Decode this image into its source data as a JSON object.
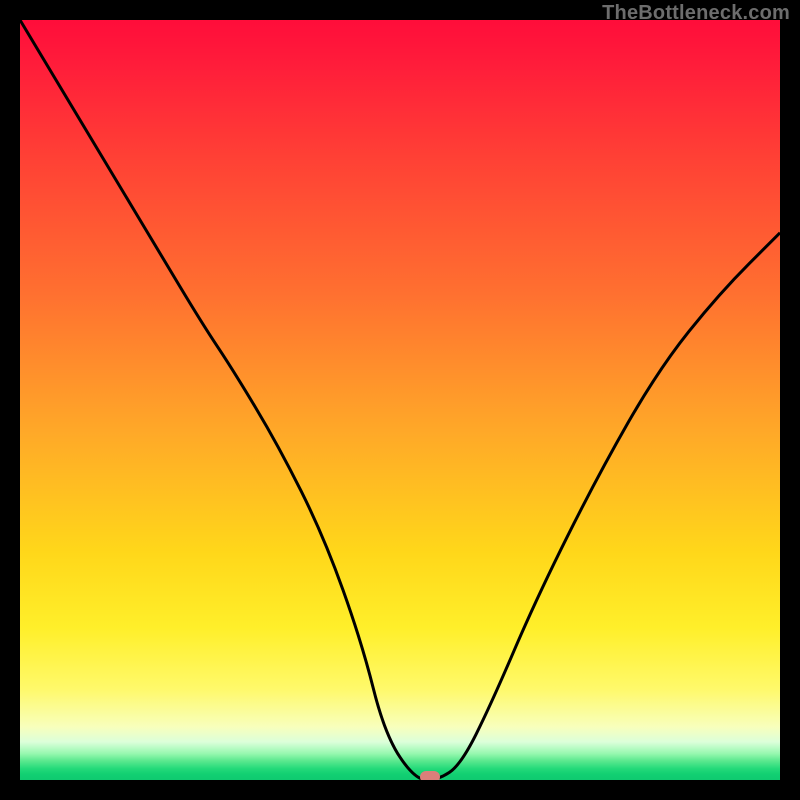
{
  "credit": "TheBottleneck.com",
  "colors": {
    "frame": "#000000",
    "curve_stroke": "#000000",
    "marker_fill": "#db7f7a",
    "credit_text": "#6d6d6d"
  },
  "chart_data": {
    "type": "line",
    "title": "",
    "xlabel": "",
    "ylabel": "",
    "xlim": [
      0,
      100
    ],
    "ylim": [
      0,
      100
    ],
    "grid": false,
    "legend": false,
    "series": [
      {
        "name": "bottleneck-curve",
        "x": [
          0,
          6,
          12,
          18,
          24,
          28,
          34,
          40,
          45,
          48,
          52,
          55,
          58,
          62,
          68,
          76,
          84,
          92,
          100
        ],
        "values": [
          100,
          90,
          80,
          70,
          60,
          54,
          44,
          32,
          18,
          6,
          0,
          0,
          2,
          10,
          24,
          40,
          54,
          64,
          72
        ]
      }
    ],
    "marker": {
      "x": 54,
      "y": 0
    },
    "notes": "Values are estimated from pixel positions; axes are unlabeled in the source image. y represents the vertical position of the black curve where 0 = bottom (green) and 100 = top (red)."
  }
}
